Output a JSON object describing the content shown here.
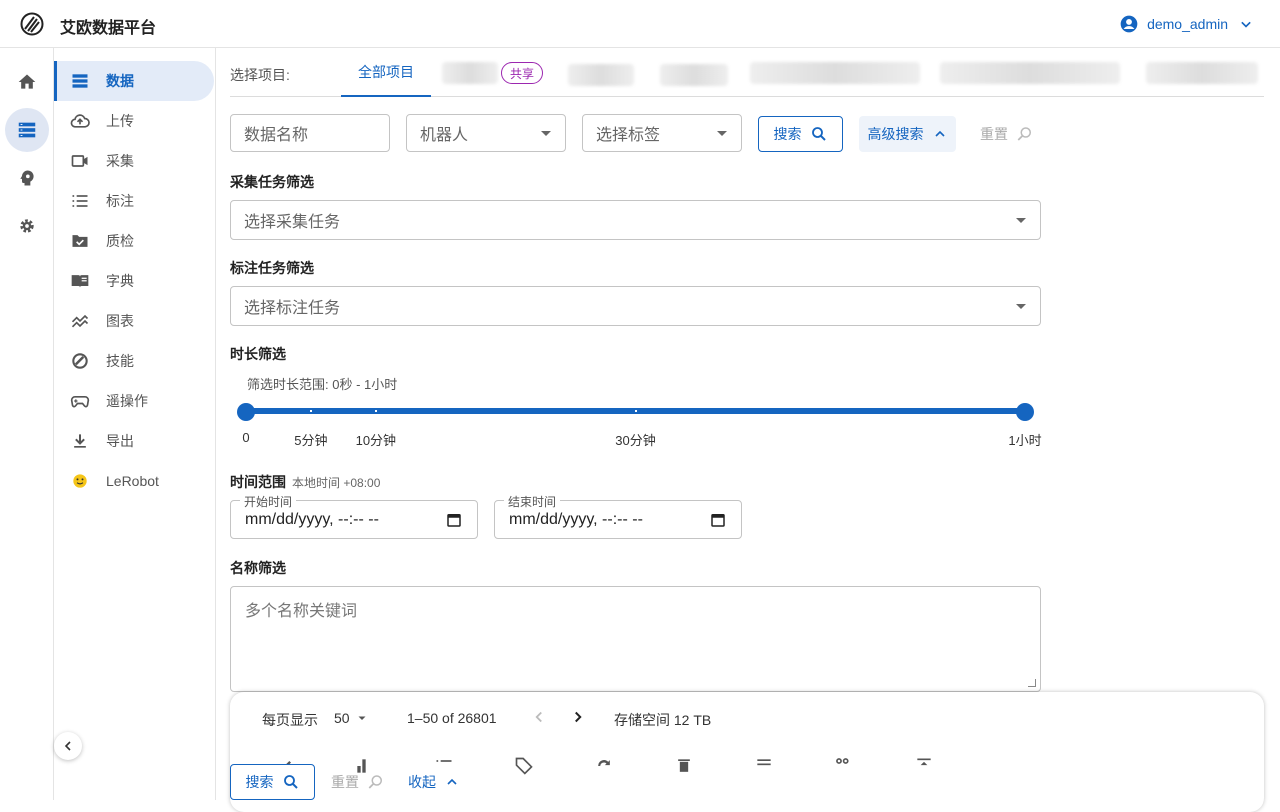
{
  "app": {
    "title": "艾欧数据平台",
    "user": "demo_admin"
  },
  "rail": [
    {
      "icon": "home-icon"
    },
    {
      "icon": "storage-icon",
      "active": true
    },
    {
      "icon": "psychology-icon"
    },
    {
      "icon": "gear-icon"
    }
  ],
  "nav": [
    {
      "label": "数据",
      "icon": "list-icon",
      "active": true
    },
    {
      "label": "上传",
      "icon": "cloud-upload-icon"
    },
    {
      "label": "采集",
      "icon": "video-camera-icon"
    },
    {
      "label": "标注",
      "icon": "format-list-icon"
    },
    {
      "label": "质检",
      "icon": "folder-check-icon"
    },
    {
      "label": "字典",
      "icon": "book-icon"
    },
    {
      "label": "图表",
      "icon": "chart-line-icon"
    },
    {
      "label": "技能",
      "icon": "skill-icon"
    },
    {
      "label": "遥操作",
      "icon": "gamepad-icon"
    },
    {
      "label": "导出",
      "icon": "download-icon"
    },
    {
      "label": "LeRobot",
      "icon": "hugging-face-icon"
    }
  ],
  "tabs": {
    "label": "选择项目:",
    "items": [
      {
        "label": "全部项目",
        "active": true
      },
      {
        "label": "共享"
      }
    ]
  },
  "filters": {
    "name_placeholder": "数据名称",
    "robot_placeholder": "机器人",
    "tag_placeholder": "选择标签",
    "search": "搜索",
    "advanced": "高级搜索",
    "reset": "重置"
  },
  "collect_filter": {
    "label": "采集任务筛选",
    "placeholder": "选择采集任务"
  },
  "label_filter": {
    "label": "标注任务筛选",
    "placeholder": "选择标注任务"
  },
  "duration": {
    "label": "时长筛选",
    "hint": "筛选时长范围: 0秒 - 1小时",
    "min_seconds": 0,
    "max_seconds": 3600,
    "selected": [
      0,
      3600
    ],
    "marks": [
      {
        "value": 0,
        "label": "0"
      },
      {
        "value": 300,
        "label": "5分钟"
      },
      {
        "value": 600,
        "label": "10分钟"
      },
      {
        "value": 1800,
        "label": "30分钟"
      },
      {
        "value": 3600,
        "label": "1小时"
      }
    ]
  },
  "time_range": {
    "label": "时间范围",
    "tz": "本地时间 +08:00",
    "start_label": "开始时间",
    "end_label": "结束时间",
    "start_value": "mm/dd/yyyy, --:-- --",
    "end_value": "mm/dd/yyyy, --:-- --"
  },
  "name_filter": {
    "label": "名称筛选",
    "placeholder": "多个名称关键词"
  },
  "pager": {
    "per_page_label": "每页显示",
    "per_page": "50",
    "range": "1–50 of 26801",
    "storage": "存储空间 12 TB"
  },
  "bottom": {
    "search": "搜索",
    "reset": "重置",
    "collapse": "收起"
  },
  "colors": {
    "primary": "#1565c0",
    "share": "#9c27b0"
  }
}
